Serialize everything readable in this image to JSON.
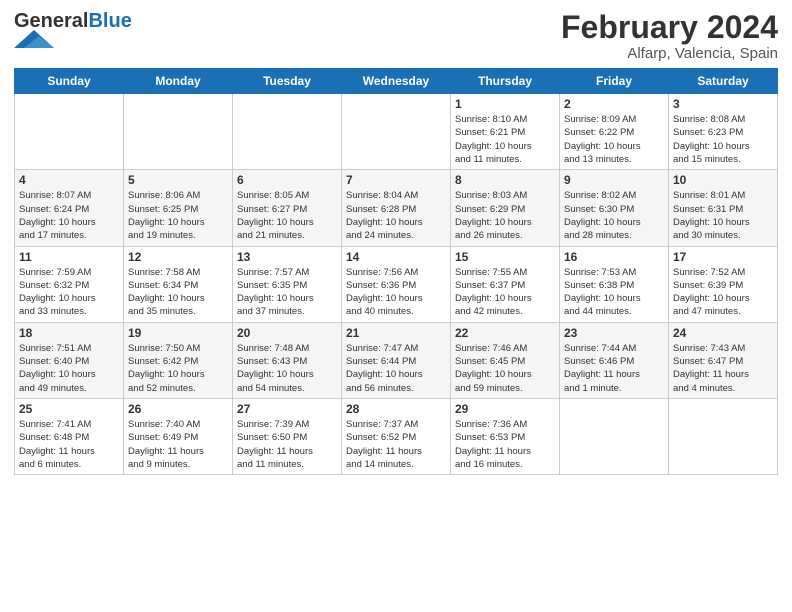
{
  "header": {
    "logo_general": "General",
    "logo_blue": "Blue",
    "main_title": "February 2024",
    "subtitle": "Alfarp, Valencia, Spain"
  },
  "days_of_week": [
    "Sunday",
    "Monday",
    "Tuesday",
    "Wednesday",
    "Thursday",
    "Friday",
    "Saturday"
  ],
  "weeks": [
    [
      {
        "day": "",
        "info": ""
      },
      {
        "day": "",
        "info": ""
      },
      {
        "day": "",
        "info": ""
      },
      {
        "day": "",
        "info": ""
      },
      {
        "day": "1",
        "info": "Sunrise: 8:10 AM\nSunset: 6:21 PM\nDaylight: 10 hours\nand 11 minutes."
      },
      {
        "day": "2",
        "info": "Sunrise: 8:09 AM\nSunset: 6:22 PM\nDaylight: 10 hours\nand 13 minutes."
      },
      {
        "day": "3",
        "info": "Sunrise: 8:08 AM\nSunset: 6:23 PM\nDaylight: 10 hours\nand 15 minutes."
      }
    ],
    [
      {
        "day": "4",
        "info": "Sunrise: 8:07 AM\nSunset: 6:24 PM\nDaylight: 10 hours\nand 17 minutes."
      },
      {
        "day": "5",
        "info": "Sunrise: 8:06 AM\nSunset: 6:25 PM\nDaylight: 10 hours\nand 19 minutes."
      },
      {
        "day": "6",
        "info": "Sunrise: 8:05 AM\nSunset: 6:27 PM\nDaylight: 10 hours\nand 21 minutes."
      },
      {
        "day": "7",
        "info": "Sunrise: 8:04 AM\nSunset: 6:28 PM\nDaylight: 10 hours\nand 24 minutes."
      },
      {
        "day": "8",
        "info": "Sunrise: 8:03 AM\nSunset: 6:29 PM\nDaylight: 10 hours\nand 26 minutes."
      },
      {
        "day": "9",
        "info": "Sunrise: 8:02 AM\nSunset: 6:30 PM\nDaylight: 10 hours\nand 28 minutes."
      },
      {
        "day": "10",
        "info": "Sunrise: 8:01 AM\nSunset: 6:31 PM\nDaylight: 10 hours\nand 30 minutes."
      }
    ],
    [
      {
        "day": "11",
        "info": "Sunrise: 7:59 AM\nSunset: 6:32 PM\nDaylight: 10 hours\nand 33 minutes."
      },
      {
        "day": "12",
        "info": "Sunrise: 7:58 AM\nSunset: 6:34 PM\nDaylight: 10 hours\nand 35 minutes."
      },
      {
        "day": "13",
        "info": "Sunrise: 7:57 AM\nSunset: 6:35 PM\nDaylight: 10 hours\nand 37 minutes."
      },
      {
        "day": "14",
        "info": "Sunrise: 7:56 AM\nSunset: 6:36 PM\nDaylight: 10 hours\nand 40 minutes."
      },
      {
        "day": "15",
        "info": "Sunrise: 7:55 AM\nSunset: 6:37 PM\nDaylight: 10 hours\nand 42 minutes."
      },
      {
        "day": "16",
        "info": "Sunrise: 7:53 AM\nSunset: 6:38 PM\nDaylight: 10 hours\nand 44 minutes."
      },
      {
        "day": "17",
        "info": "Sunrise: 7:52 AM\nSunset: 6:39 PM\nDaylight: 10 hours\nand 47 minutes."
      }
    ],
    [
      {
        "day": "18",
        "info": "Sunrise: 7:51 AM\nSunset: 6:40 PM\nDaylight: 10 hours\nand 49 minutes."
      },
      {
        "day": "19",
        "info": "Sunrise: 7:50 AM\nSunset: 6:42 PM\nDaylight: 10 hours\nand 52 minutes."
      },
      {
        "day": "20",
        "info": "Sunrise: 7:48 AM\nSunset: 6:43 PM\nDaylight: 10 hours\nand 54 minutes."
      },
      {
        "day": "21",
        "info": "Sunrise: 7:47 AM\nSunset: 6:44 PM\nDaylight: 10 hours\nand 56 minutes."
      },
      {
        "day": "22",
        "info": "Sunrise: 7:46 AM\nSunset: 6:45 PM\nDaylight: 10 hours\nand 59 minutes."
      },
      {
        "day": "23",
        "info": "Sunrise: 7:44 AM\nSunset: 6:46 PM\nDaylight: 11 hours\nand 1 minute."
      },
      {
        "day": "24",
        "info": "Sunrise: 7:43 AM\nSunset: 6:47 PM\nDaylight: 11 hours\nand 4 minutes."
      }
    ],
    [
      {
        "day": "25",
        "info": "Sunrise: 7:41 AM\nSunset: 6:48 PM\nDaylight: 11 hours\nand 6 minutes."
      },
      {
        "day": "26",
        "info": "Sunrise: 7:40 AM\nSunset: 6:49 PM\nDaylight: 11 hours\nand 9 minutes."
      },
      {
        "day": "27",
        "info": "Sunrise: 7:39 AM\nSunset: 6:50 PM\nDaylight: 11 hours\nand 11 minutes."
      },
      {
        "day": "28",
        "info": "Sunrise: 7:37 AM\nSunset: 6:52 PM\nDaylight: 11 hours\nand 14 minutes."
      },
      {
        "day": "29",
        "info": "Sunrise: 7:36 AM\nSunset: 6:53 PM\nDaylight: 11 hours\nand 16 minutes."
      },
      {
        "day": "",
        "info": ""
      },
      {
        "day": "",
        "info": ""
      }
    ]
  ]
}
